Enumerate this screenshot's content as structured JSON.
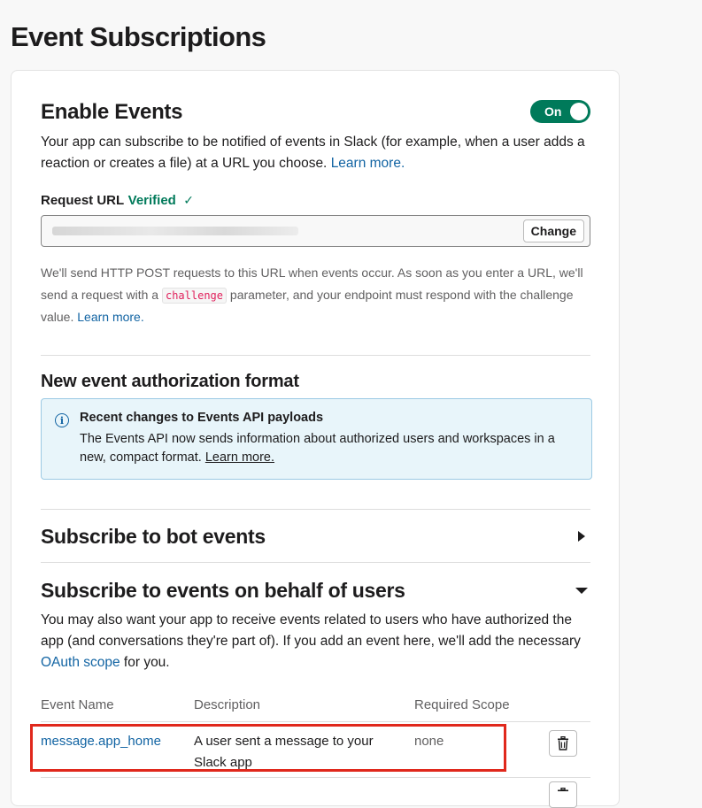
{
  "page": {
    "title": "Event Subscriptions"
  },
  "enable_events": {
    "title": "Enable Events",
    "toggle_label": "On",
    "description": "Your app can subscribe to be notified of events in Slack (for example, when a user adds a reaction or creates a file) at a URL you choose.",
    "learn_more": "Learn more.",
    "request_url": {
      "label": "Request URL",
      "status": "Verified",
      "check": "✓",
      "change_button": "Change"
    },
    "help": {
      "before": "We'll send HTTP POST requests to this URL when events occur. As soon as you enter a URL, we'll send a request with a",
      "code": "challenge",
      "after": "parameter, and your endpoint must respond with the challenge value.",
      "learn_more": "Learn more."
    }
  },
  "auth_format": {
    "title": "New event authorization format",
    "info_icon": "i",
    "info_title": "Recent changes to Events API payloads",
    "info_body": "The Events API now sends information about authorized users and workspaces in a new, compact format.",
    "info_link": "Learn more."
  },
  "bot_events": {
    "title": "Subscribe to bot events",
    "icon": "caret-right-icon"
  },
  "user_events": {
    "title": "Subscribe to events on behalf of users",
    "icon": "caret-down-icon",
    "description_before": "You may also want your app to receive events related to users who have authorized the app (and conversations they're part of). If you add an event here, we'll add the necessary",
    "oauth_link": "OAuth scope",
    "description_after": "for you.",
    "table": {
      "headers": [
        "Event Name",
        "Description",
        "Required Scope"
      ],
      "rows": [
        {
          "name": "message.app_home",
          "description": "A user sent a message to your Slack app",
          "scope": "none"
        }
      ]
    }
  },
  "colors": {
    "accent_green": "#007a5a",
    "link_blue": "#1264a3",
    "highlight_red": "#e0281c"
  }
}
